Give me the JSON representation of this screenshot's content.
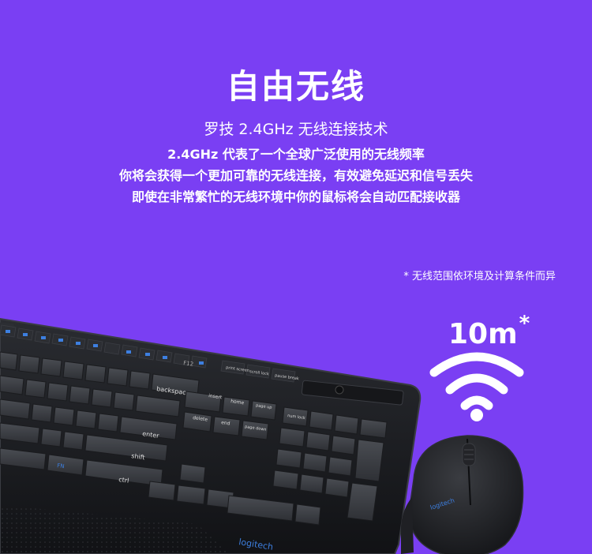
{
  "feature": {
    "title": "自由无线",
    "subtitle": "罗技 2.4GHz 无线连接技术",
    "lines": [
      "2.4GHz 代表了一个全球广泛使用的无线频率",
      "你将会获得一个更加可靠的无线连接，有效避免延迟和信号丢失",
      "即使在非常繁忙的无线环境中你的鼠标将会自动匹配接收器"
    ],
    "footnote": "* 无线范围依环境及计算条件而异",
    "range_value": "10m",
    "range_mark": "*"
  },
  "product": {
    "keyboard_keys": {
      "backspace": "backspace",
      "enter": "enter",
      "shift": "shift",
      "ctrl": "ctrl",
      "insert": "insert",
      "home": "home",
      "page_up": "page up",
      "delete": "delete",
      "end": "end",
      "page_down": "page down",
      "num_lock": "num lock",
      "fn": "FN",
      "prt_scr": "print screen",
      "scroll_lock": "scroll lock",
      "pause": "pause break",
      "f12": "F12"
    },
    "keyboard_brand": "logitech",
    "mouse_brand": "logitech"
  },
  "colors": {
    "background": "#7a3ff3",
    "text": "#ffffff",
    "device": "#1a1b1f"
  }
}
